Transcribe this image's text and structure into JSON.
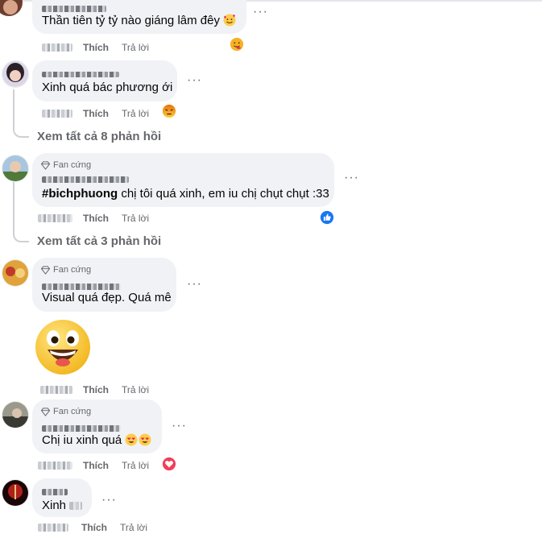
{
  "comments": [
    {
      "text": "Thần tiên tỷ tỷ nào giáng lâm đêy",
      "emoji": "smiling-face-with-hearts",
      "actions": {
        "like": "Thích",
        "reply": "Trả lời"
      },
      "reaction": "hug-reaction"
    },
    {
      "text": "Xinh quá bác phương ới",
      "actions": {
        "like": "Thích",
        "reply": "Trả lời"
      },
      "reaction": "angry-reaction",
      "replies_link": "Xem tất cả 8 phản hồi"
    },
    {
      "badge": "Fan cứng",
      "hashtag": "#bichphuong",
      "text": " chị tôi quá xinh, em iu chị chụt chụt :33",
      "actions": {
        "like": "Thích",
        "reply": "Trả lời"
      },
      "reaction": "like-reaction",
      "replies_link": "Xem tất cả 3 phản hồi"
    },
    {
      "badge": "Fan cứng",
      "text": "Visual quá đẹp. Quá mê",
      "sticker": "grinning-face-sticker",
      "actions": {
        "like": "Thích",
        "reply": "Trả lời"
      }
    },
    {
      "badge": "Fan cứng",
      "text": "Chị iu xinh quá",
      "emoji": "heart-eyes",
      "actions": {
        "like": "Thích",
        "reply": "Trả lời"
      },
      "reaction": "love-reaction"
    },
    {
      "text": "Xinh",
      "actions": {
        "like": "Thích",
        "reply": "Trả lời"
      }
    }
  ],
  "colors": {
    "bubble": "#f0f2f5",
    "secondary_text": "#65676b",
    "like_blue": "#1877f2",
    "love_red": "#f33e58",
    "angry_orange": "#e9710f"
  }
}
